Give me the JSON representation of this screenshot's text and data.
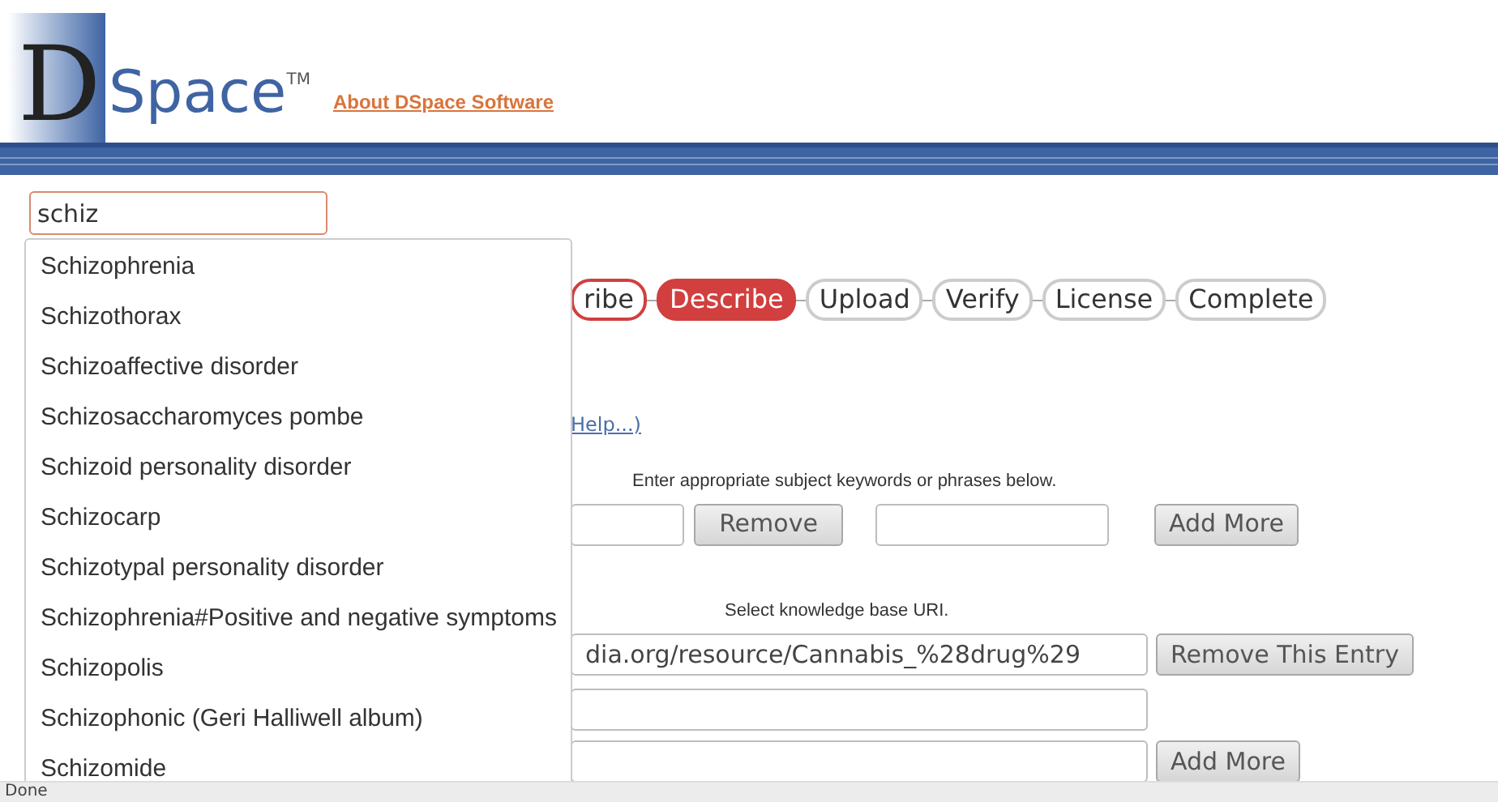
{
  "header": {
    "logo_letter": "D",
    "logo_word": "Space",
    "trademark": "TM",
    "about_link": "About DSpace Software"
  },
  "search": {
    "value": "schiz"
  },
  "suggestions": [
    "Schizophrenia",
    "Schizothorax",
    "Schizoaffective disorder",
    "Schizosaccharomyces pombe",
    "Schizoid personality disorder",
    "Schizocarp",
    "Schizotypal personality disorder",
    "Schizophrenia#Positive and negative symptoms",
    "Schizopolis",
    "Schizophonic (Geri Halliwell album)",
    "Schizomide"
  ],
  "steps": [
    {
      "label": "ribe",
      "selected": false,
      "done": true
    },
    {
      "label": "Describe",
      "selected": true,
      "done": false
    },
    {
      "label": "Upload",
      "selected": false,
      "done": false
    },
    {
      "label": "Verify",
      "selected": false,
      "done": false
    },
    {
      "label": "License",
      "selected": false,
      "done": false
    },
    {
      "label": "Complete",
      "selected": false,
      "done": false
    }
  ],
  "help_link": "Help...)",
  "keywords": {
    "hint": "Enter appropriate subject keywords or phrases below.",
    "remove_button": "Remove",
    "add_button": "Add More"
  },
  "uri": {
    "hint": "Select knowledge base URI.",
    "value": "dia.org/resource/Cannabis_%28drug%29",
    "remove_button": "Remove This Entry",
    "add_button": "Add More"
  },
  "status_bar": "Done"
}
